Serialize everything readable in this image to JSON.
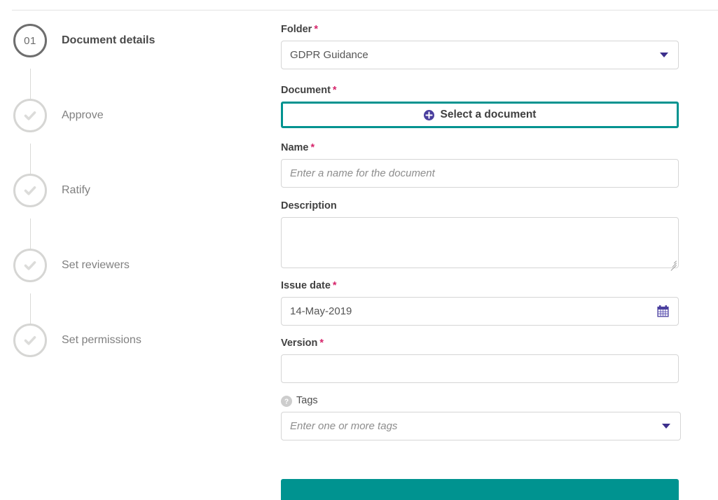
{
  "stepper": {
    "steps": [
      {
        "label": "Document details",
        "state": "active",
        "number": "01",
        "icon": "number-badge"
      },
      {
        "label": "Approve",
        "state": "done",
        "number": "",
        "icon": "check-icon"
      },
      {
        "label": "Ratify",
        "state": "done",
        "number": "",
        "icon": "check-icon"
      },
      {
        "label": "Set reviewers",
        "state": "done",
        "number": "",
        "icon": "check-icon"
      },
      {
        "label": "Set permissions",
        "state": "done",
        "number": "",
        "icon": "check-icon"
      }
    ]
  },
  "form": {
    "folder": {
      "label": "Folder",
      "required": "*",
      "value": "GDPR Guidance",
      "icon": "chevron-down-icon"
    },
    "document": {
      "label": "Document",
      "required": "*",
      "button_label": "Select a document",
      "icon": "plus-circle-icon"
    },
    "name": {
      "label": "Name",
      "required": "*",
      "value": "",
      "placeholder": "Enter a name for the document"
    },
    "description": {
      "label": "Description",
      "required": "",
      "value": "",
      "placeholder": ""
    },
    "issue_date": {
      "label": "Issue date",
      "required": "*",
      "value": "14-May-2019",
      "icon": "calendar-icon"
    },
    "version": {
      "label": "Version",
      "required": "*",
      "value": "",
      "placeholder": ""
    },
    "tags": {
      "label": "Tags",
      "required": "",
      "value": "",
      "placeholder": "Enter one or more tags",
      "help_icon": "help-circle-icon",
      "help_glyph": "?",
      "icon": "chevron-down-icon"
    },
    "submit": {
      "label": ""
    }
  },
  "colors": {
    "teal": "#009390",
    "required_pink": "#d6256b",
    "accent_indigo": "#3c2f8c",
    "step_active": "#6e6e6e",
    "step_done": "#d6d6d4"
  }
}
